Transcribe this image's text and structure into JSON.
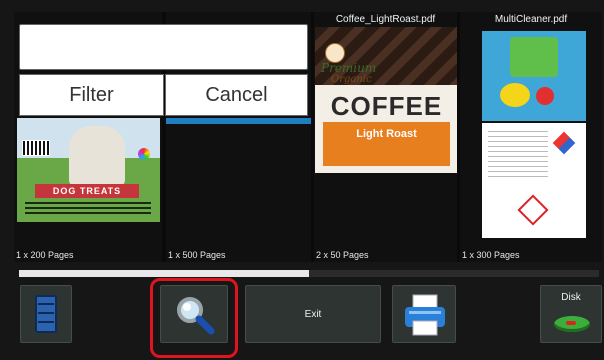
{
  "search": {
    "value": "",
    "placeholder": ""
  },
  "overlay": {
    "filter_label": "Filter",
    "cancel_label": "Cancel"
  },
  "tiles": [
    {
      "title": "",
      "pages": "1 x 200 Pages",
      "banner_text": "DOG TREATS"
    },
    {
      "title": "",
      "pages": "1 x 500 Pages"
    },
    {
      "title": "Coffee_LightRoast.pdf",
      "pages": "2 x 50 Pages",
      "label_premium": "Premium",
      "label_organic": "Organic",
      "label_coffee": "COFFEE",
      "label_sub": "Light Roast"
    },
    {
      "title": "MultiCleaner.pdf",
      "pages": "1 x 300 Pages"
    }
  ],
  "progress": {
    "fraction": 0.5
  },
  "toolbar": {
    "exit_label": "Exit",
    "disk_label": "Disk"
  },
  "icons": {
    "list": "list-icon",
    "search": "magnifier-icon",
    "printer": "printer-icon",
    "disk": "disk-icon"
  },
  "colors": {
    "highlight": "#e0141e",
    "button_bg": "#2e3431",
    "list_blue": "#2b63b0",
    "disk_green": "#3cae3c"
  }
}
